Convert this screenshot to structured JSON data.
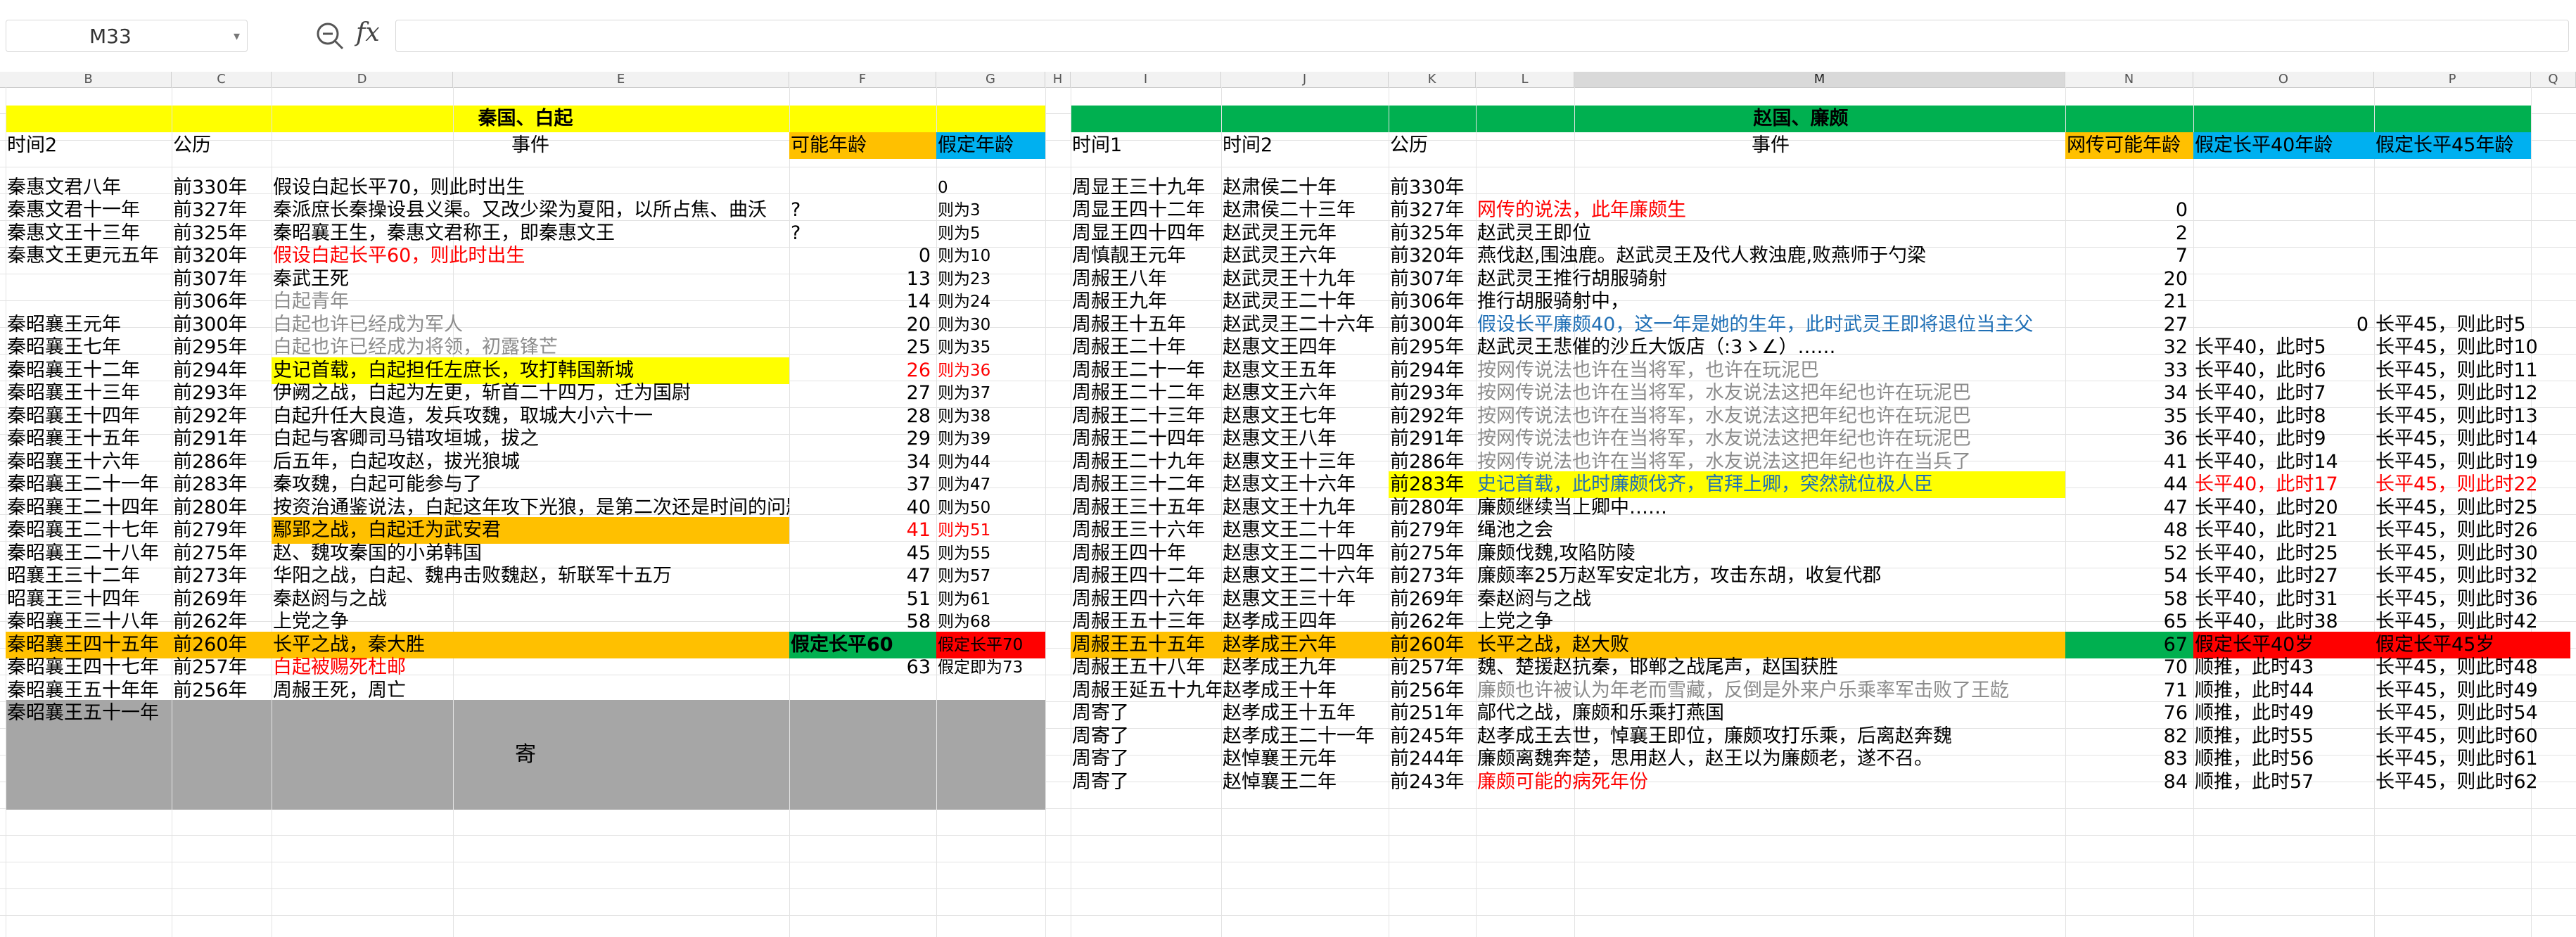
{
  "toolbar": {
    "cell_ref": "M33",
    "zoom_icon": "zoom-icon",
    "fx_label": "fx"
  },
  "columns": [
    "B",
    "C",
    "D",
    "E",
    "F",
    "G",
    "H",
    "I",
    "J",
    "K",
    "L",
    "M",
    "N",
    "O",
    "P",
    "Q"
  ],
  "selected_column": "M",
  "left": {
    "title": "秦国、白起",
    "headers": [
      "时间2",
      "公历",
      "事件",
      "可能年龄",
      "假定年龄"
    ],
    "rows": [
      {
        "t": "秦惠文君八年",
        "y": "前330年",
        "e": "假设白起长平70，则此时出生",
        "a": "",
        "g": "0"
      },
      {
        "t": "秦惠文君十一年",
        "y": "前327年",
        "e": "秦派庶长秦操设县义渠。又改少梁为夏阳，以所占焦、曲沃",
        "a": "?",
        "g": "则为3"
      },
      {
        "t": "秦惠文王十三年",
        "y": "前325年",
        "e": "秦昭襄王生，秦惠文君称王，即秦惠文王",
        "a": "?",
        "g": "则为5"
      },
      {
        "t": "秦惠文王更元五年",
        "y": "前320年",
        "e": "假设白起长平60，则此时出生",
        "a": "0",
        "g": "则为10"
      },
      {
        "t": "",
        "y": "前307年",
        "e": "秦武王死",
        "a": "13",
        "g": "则为23"
      },
      {
        "t": "",
        "y": "前306年",
        "e": "白起青年",
        "a": "14",
        "g": "则为24"
      },
      {
        "t": "秦昭襄王元年",
        "y": "前300年",
        "e": "白起也许已经成为军人",
        "a": "20",
        "g": "则为30"
      },
      {
        "t": "秦昭襄王七年",
        "y": "前295年",
        "e": "白起也许已经成为将领，初露锋芒",
        "a": "25",
        "g": "则为35"
      },
      {
        "t": "秦昭襄王十二年",
        "y": "前294年",
        "e": "史记首载，白起担任左庶长，攻打韩国新城",
        "a": "26",
        "g": "则为36"
      },
      {
        "t": "秦昭襄王十三年",
        "y": "前293年",
        "e": "伊阙之战，白起为左更，斩首二十四万，迁为国尉",
        "a": "27",
        "g": "则为37"
      },
      {
        "t": "秦昭襄王十四年",
        "y": "前292年",
        "e": "白起升任大良造，发兵攻魏，取城大小六十一",
        "a": "28",
        "g": "则为38"
      },
      {
        "t": "秦昭襄王十五年",
        "y": "前291年",
        "e": "白起与客卿司马错攻垣城，拔之",
        "a": "29",
        "g": "则为39"
      },
      {
        "t": "秦昭襄王十六年",
        "y": "前286年",
        "e": "后五年，白起攻赵，拔光狼城",
        "a": "34",
        "g": "则为44"
      },
      {
        "t": "秦昭襄王二十一年",
        "y": "前283年",
        "e": "秦攻魏，白起可能参与了",
        "a": "37",
        "g": "则为47"
      },
      {
        "t": "秦昭襄王二十四年",
        "y": "前280年",
        "e": "按资治通鉴说法，白起这年攻下光狼，是第二次还是时间的问题",
        "a": "40",
        "g": "则为50"
      },
      {
        "t": "秦昭襄王二十七年",
        "y": "前279年",
        "e": "鄢郢之战，白起迁为武安君",
        "a": "41",
        "g": "则为51"
      },
      {
        "t": "秦昭襄王二十八年",
        "y": "前275年",
        "e": "赵、魏攻秦国的小弟韩国",
        "a": "45",
        "g": "则为55"
      },
      {
        "t": "昭襄王三十二年",
        "y": "前273年",
        "e": "华阳之战，白起、魏冉击败魏赵，斩联军十五万",
        "a": "47",
        "g": "则为57"
      },
      {
        "t": "昭襄王三十四年",
        "y": "前269年",
        "e": "秦赵阏与之战",
        "a": "51",
        "g": "则为61"
      },
      {
        "t": "秦昭襄王三十八年",
        "y": "前262年",
        "e": "上党之争",
        "a": "58",
        "g": "则为68"
      },
      {
        "t": "秦昭襄王四十五年",
        "y": "前260年",
        "e": "长平之战，秦大胜",
        "a": "假定长平60",
        "g": "假定长平70"
      },
      {
        "t": "秦昭襄王四十七年",
        "y": "前257年",
        "e": "白起被赐死杜邮",
        "a": "63",
        "g": "假定即为73"
      },
      {
        "t": "秦昭襄王五十年年",
        "y": "前256年",
        "e": "周赧王死，周亡",
        "a": "",
        "g": ""
      },
      {
        "t": "秦昭襄王五十一年",
        "y": "",
        "e": "",
        "a": "",
        "g": ""
      }
    ],
    "merged_label": "寄"
  },
  "right": {
    "title": "赵国、廉颇",
    "headers": [
      "时间1",
      "时间2",
      "公历",
      "事件",
      "网传可能年龄",
      "假定长平40年龄",
      "假定长平45年龄"
    ],
    "rows": [
      {
        "t1": "周显王三十九年",
        "t2": "赵肃侯二十年",
        "y": "前330年",
        "e": "",
        "a": "",
        "o": "",
        "p": ""
      },
      {
        "t1": "周显王四十二年",
        "t2": "赵肃侯二十三年",
        "y": "前327年",
        "e": "网传的说法，此年廉颇生",
        "a": "0",
        "o": "",
        "p": ""
      },
      {
        "t1": "周显王四十四年",
        "t2": "赵武灵王元年",
        "y": "前325年",
        "e": "赵武灵王即位",
        "a": "2",
        "o": "",
        "p": ""
      },
      {
        "t1": "周慎靓王元年",
        "t2": "赵武灵王六年",
        "y": "前320年",
        "e": "燕伐赵,围浊鹿。赵武灵王及代人救浊鹿,败燕师于勺梁",
        "a": "7",
        "o": "",
        "p": ""
      },
      {
        "t1": "周赧王八年",
        "t2": "赵武灵王十九年",
        "y": "前307年",
        "e": "赵武灵王推行胡服骑射",
        "a": "20",
        "o": "",
        "p": ""
      },
      {
        "t1": "周赧王九年",
        "t2": "赵武灵王二十年",
        "y": "前306年",
        "e": "推行胡服骑射中，",
        "a": "21",
        "o": "",
        "p": ""
      },
      {
        "t1": "周赧王十五年",
        "t2": "赵武灵王二十六年",
        "y": "前300年",
        "e": "假设长平廉颇40，这一年是她的生年，此时武灵王即将退位当主父",
        "a": "27",
        "o": "0",
        "p": "长平45，则此时5"
      },
      {
        "t1": "周赧王二十年",
        "t2": "赵惠文王四年",
        "y": "前295年",
        "e": "赵武灵王悲催的沙丘大饭店（:3ゝ∠）……",
        "a": "32",
        "o": "长平40，此时5",
        "p": "长平45，则此时10"
      },
      {
        "t1": "周赧王二十一年",
        "t2": "赵惠文王五年",
        "y": "前294年",
        "e": "按网传说法也许在当将军，也许在玩泥巴",
        "a": "33",
        "o": "长平40，此时6",
        "p": "长平45，则此时11"
      },
      {
        "t1": "周赧王二十二年",
        "t2": "赵惠文王六年",
        "y": "前293年",
        "e": "按网传说法也许在当将军，水友说法这把年纪也许在玩泥巴",
        "a": "34",
        "o": "长平40，此时7",
        "p": "长平45，则此时12"
      },
      {
        "t1": "周赧王二十三年",
        "t2": "赵惠文王七年",
        "y": "前292年",
        "e": "按网传说法也许在当将军，水友说法这把年纪也许在玩泥巴",
        "a": "35",
        "o": "长平40，此时8",
        "p": "长平45，则此时13"
      },
      {
        "t1": "周赧王二十四年",
        "t2": "赵惠文王八年",
        "y": "前291年",
        "e": "按网传说法也许在当将军，水友说法这把年纪也许在玩泥巴",
        "a": "36",
        "o": "长平40，此时9",
        "p": "长平45，则此时14"
      },
      {
        "t1": "周赧王二十九年",
        "t2": "赵惠文王十三年",
        "y": "前286年",
        "e": "按网传说法也许在当将军，水友说法这把年纪也许在当兵了",
        "a": "41",
        "o": "长平40，此时14",
        "p": "长平45，则此时19"
      },
      {
        "t1": "周赧王三十二年",
        "t2": "赵惠文王十六年",
        "y": "前283年",
        "e": "史记首载，此时廉颇伐齐，官拜上卿，突然就位极人臣",
        "a": "44",
        "o": "长平40，此时17",
        "p": "长平45，则此时22"
      },
      {
        "t1": "周赧王三十五年",
        "t2": "赵惠文王十九年",
        "y": "前280年",
        "e": "廉颇继续当上卿中……",
        "a": "47",
        "o": "长平40，此时20",
        "p": "长平45，则此时25"
      },
      {
        "t1": "周赧王三十六年",
        "t2": "赵惠文王二十年",
        "y": "前279年",
        "e": "绳池之会",
        "a": "48",
        "o": "长平40，此时21",
        "p": "长平45，则此时26"
      },
      {
        "t1": "周赧王四十年",
        "t2": "赵惠文王二十四年",
        "y": "前275年",
        "e": "廉颇伐魏,攻陷防陵",
        "a": "52",
        "o": "长平40，此时25",
        "p": "长平45，则此时30"
      },
      {
        "t1": "周赧王四十二年",
        "t2": "赵惠文王二十六年",
        "y": "前273年",
        "e": "廉颇率25万赵军安定北方，攻击东胡，收复代郡",
        "a": "54",
        "o": "长平40，此时27",
        "p": "长平45，则此时32"
      },
      {
        "t1": "周赧王四十六年",
        "t2": "赵惠文王三十年",
        "y": "前269年",
        "e": "秦赵阏与之战",
        "a": "58",
        "o": "长平40，此时31",
        "p": "长平45，则此时36"
      },
      {
        "t1": "周赧王五十三年",
        "t2": "赵孝成王四年",
        "y": "前262年",
        "e": "上党之争",
        "a": "65",
        "o": "长平40，此时38",
        "p": "长平45，则此时42"
      },
      {
        "t1": "周赧王五十五年",
        "t2": "赵孝成王六年",
        "y": "前260年",
        "e": "长平之战，赵大败",
        "a": "67",
        "o": "假定长平40岁",
        "p": "假定长平45岁"
      },
      {
        "t1": "周赧王五十八年",
        "t2": "赵孝成王九年",
        "y": "前257年",
        "e": "魏、楚援赵抗秦，邯郸之战尾声，赵国获胜",
        "a": "70",
        "o": "顺推，此时43",
        "p": "长平45，则此时48"
      },
      {
        "t1": "周赧王延五十九年",
        "t2": "赵孝成王十年",
        "y": "前256年",
        "e": "廉颇也许被认为年老而雪藏，反倒是外来户乐乘率军击败了王龁",
        "a": "71",
        "o": "顺推，此时44",
        "p": "长平45，则此时49"
      },
      {
        "t1": "周寄了",
        "t2": "赵孝成王十五年",
        "y": "前251年",
        "e": "鄗代之战，廉颇和乐乘打燕国",
        "a": "76",
        "o": "顺推，此时49",
        "p": "长平45，则此时54"
      },
      {
        "t1": "周寄了",
        "t2": "赵孝成王二十一年",
        "y": "前245年",
        "e": "赵孝成王去世，悼襄王即位，廉颇攻打乐乘，后离赵奔魏",
        "a": "82",
        "o": "顺推，此时55",
        "p": "长平45，则此时60"
      },
      {
        "t1": "周寄了",
        "t2": "赵悼襄王元年",
        "y": "前244年",
        "e": "廉颇离魏奔楚，思用赵人，赵王以为廉颇老，遂不召。",
        "a": "83",
        "o": "顺推，此时56",
        "p": "长平45，则此时61"
      },
      {
        "t1": "周寄了",
        "t2": "赵悼襄王二年",
        "y": "前243年",
        "e": "廉颇可能的病死年份",
        "a": "84",
        "o": "顺推，此时57",
        "p": "长平45，则此时62"
      }
    ]
  }
}
